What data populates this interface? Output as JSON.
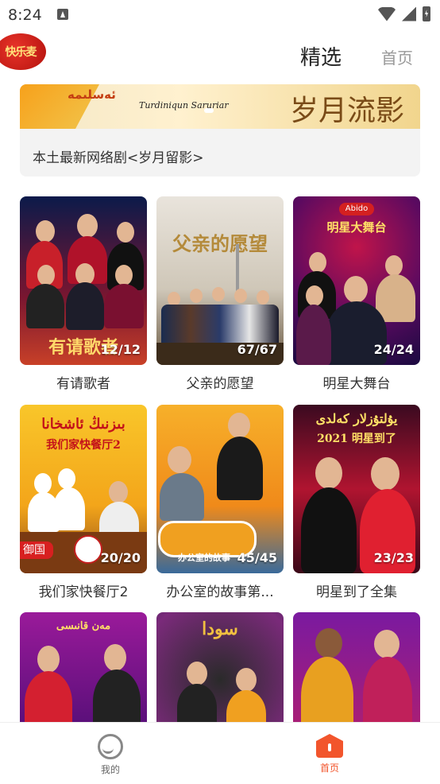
{
  "status": {
    "time": "8:24"
  },
  "header": {
    "logo_text": "快乐麦",
    "tabs": [
      {
        "label": "精选",
        "active": true
      },
      {
        "label": "首页",
        "active": false
      }
    ]
  },
  "banner": {
    "caption": "本土最新网络剧<岁月留影>",
    "overlay_text": "岁月流影",
    "overlay_subtext": "Turdiniqun Saruriar"
  },
  "cards": [
    {
      "title": "有请歌者",
      "count": "12/12",
      "poster_title": "有请歌者"
    },
    {
      "title": "父亲的愿望",
      "count": "67/67",
      "poster_title": "父亲的愿望"
    },
    {
      "title": "明星大舞台",
      "count": "24/24",
      "poster_title": "明星大舞台"
    },
    {
      "title": "我们家快餐厅2",
      "count": "20/20",
      "poster_title": "我们家快餐厅2"
    },
    {
      "title": "办公室的故事第...",
      "count": "45/45",
      "poster_title": "办公室的故事"
    },
    {
      "title": "明星到了全集",
      "count": "23/23",
      "poster_title": "2021 明星到了"
    },
    {
      "title": "",
      "count": "",
      "poster_title": ""
    },
    {
      "title": "",
      "count": "",
      "poster_title": ""
    },
    {
      "title": "",
      "count": "",
      "poster_title": ""
    }
  ],
  "tabbar": {
    "items": [
      {
        "label": "我的",
        "icon": "user-icon",
        "color": "#666666"
      },
      {
        "label": "首页",
        "icon": "home-icon",
        "color": "#f2552c"
      }
    ]
  },
  "colors": {
    "accent": "#f2552c",
    "text": "#333333",
    "muted": "#999999"
  }
}
